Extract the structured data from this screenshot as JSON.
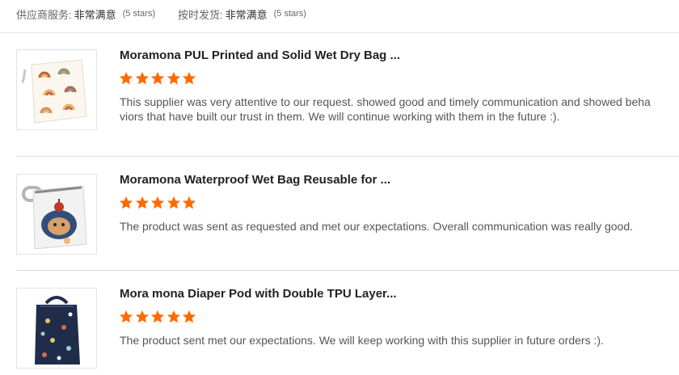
{
  "supplier_rating": {
    "service_label": "供应商服务:",
    "service_value": "非常满意",
    "service_stars": "(5 stars)",
    "shipping_label": "按时发货:",
    "shipping_value": "非常满意",
    "shipping_stars": "(5 stars)"
  },
  "colors": {
    "star": "#ff6a00",
    "text": "#555555",
    "divider": "#dcdcdc"
  },
  "reviews": [
    {
      "title": "Moramona PUL Printed and Solid Wet Dry Bag ...",
      "rating": 5,
      "comment": "This supplier was very attentive to our request. showed good and timely communication and showed behaviors that have built our trust in them. We will continue working with them in the future :).",
      "image_icon": "rainbow-print-wet-bag"
    },
    {
      "title": "Moramona Waterproof Wet Bag Reusable for ...",
      "rating": 5,
      "comment": "The product was sent as requested and met our expectations. Overall communication was really good.",
      "image_icon": "hedgehog-print-wet-bag"
    },
    {
      "title": "Mora mona Diaper Pod with Double TPU Layer...",
      "rating": 5,
      "comment": "The product sent met our expectations. We will keep working with this supplier in future orders :).",
      "image_icon": "navy-print-diaper-pod"
    }
  ]
}
